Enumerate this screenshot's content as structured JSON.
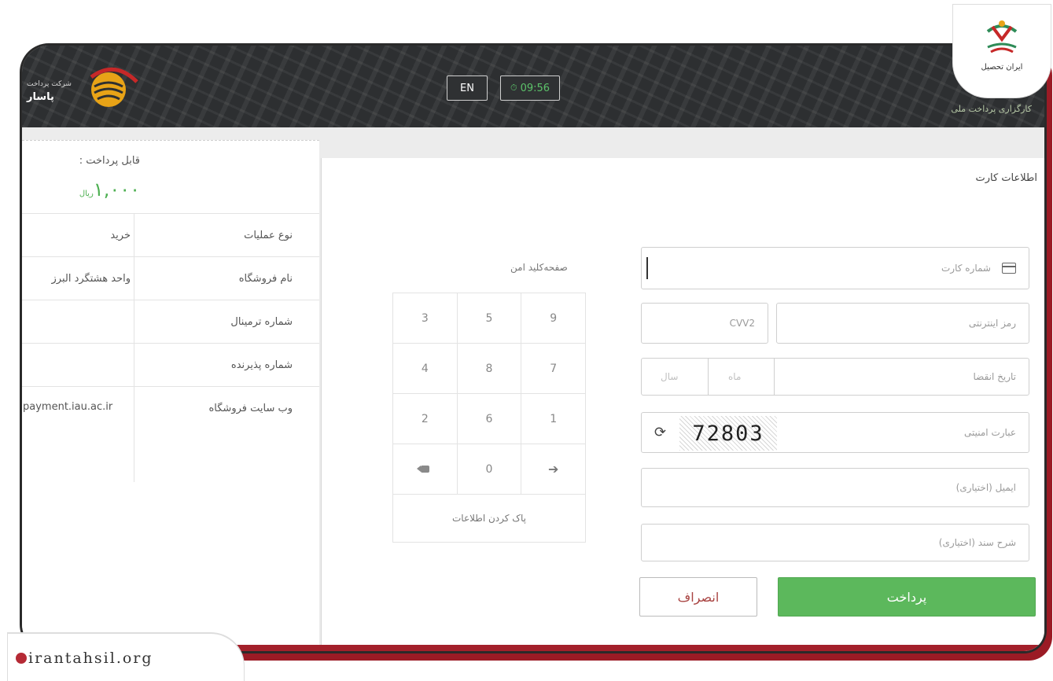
{
  "header": {
    "company_small": "شرکت پرداخت",
    "company_name": "پاسار",
    "lang_label": "EN",
    "timer": "09:56",
    "right_subtitle": "کارگزاری پرداخت ملی"
  },
  "info": {
    "payable_label": "قابل پرداخت :",
    "amount": "۱,۰۰۰",
    "amount_unit": "ریال",
    "rows": [
      {
        "label": "نوع عملیات",
        "value": "خرید"
      },
      {
        "label": "نام فروشگاه",
        "value": "واحد هشتگرد البرز"
      },
      {
        "label": "شماره ترمینال",
        "value": ""
      },
      {
        "label": "شماره پذیرنده",
        "value": ""
      },
      {
        "label": "وب سایت فروشگاه",
        "value": "payment.iau.ac.ir"
      }
    ]
  },
  "card": {
    "title": "اطلاعات کارت",
    "card_number_placeholder": "شماره کارت",
    "cvv2_placeholder": "CVV2",
    "password_placeholder": "رمز اینترنتی",
    "expiry_placeholder": "تاریخ انقضا",
    "month_placeholder": "ماه",
    "year_placeholder": "سال",
    "captcha_placeholder": "عبارت امنیتی",
    "captcha_code": "72803",
    "email_placeholder": "ایمیل (اختیاری)",
    "desc_placeholder": "شرح سند (اختیاری)",
    "pay_label": "پرداخت",
    "cancel_label": "انصراف"
  },
  "keypad": {
    "title": "صفحه‌کلید امن",
    "rows": [
      [
        "3",
        "5",
        "9"
      ],
      [
        "4",
        "8",
        "7"
      ],
      [
        "2",
        "6",
        "1"
      ]
    ],
    "zero": "0",
    "clear_label": "پاک کردن اطلاعات"
  },
  "overlays": {
    "badge_text": "ایران تحصیل",
    "watermark": "irantahsil.org"
  },
  "colors": {
    "accent_green": "#5cb85c",
    "amount_green": "#4caf50",
    "timer_green": "#5cc26a",
    "brand_red": "#a3202a",
    "header_dark": "#2d2f31"
  }
}
